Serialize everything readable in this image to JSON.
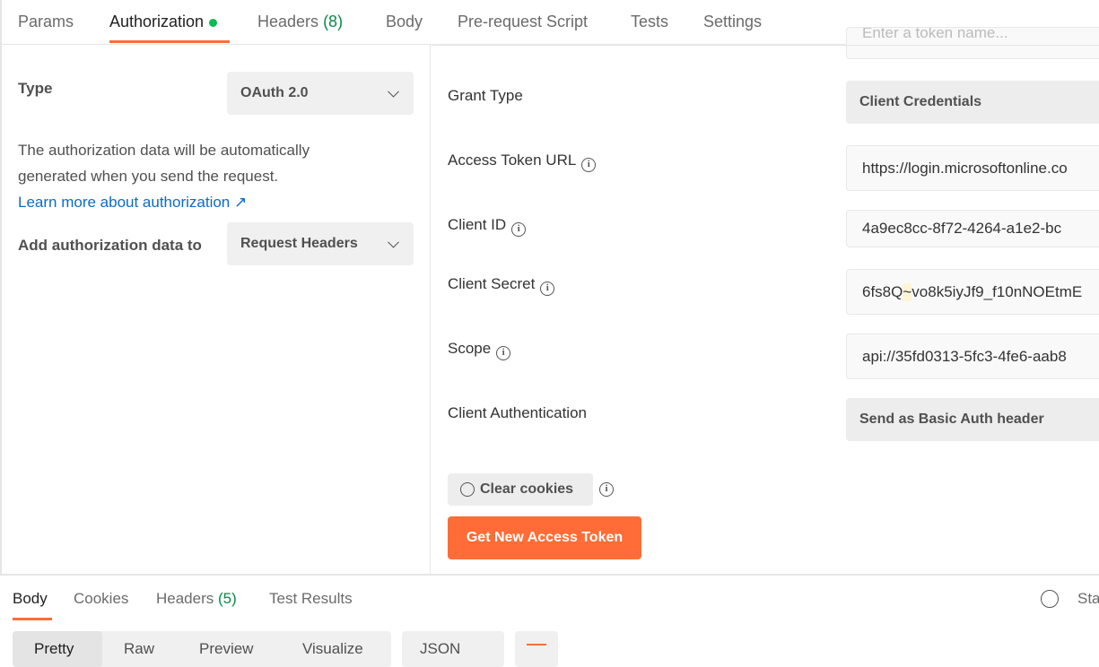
{
  "request_tabs": [
    {
      "label": "Params"
    },
    {
      "label": "Authorization",
      "active": true,
      "indicator_color": "#0cbb52"
    },
    {
      "label": "Headers",
      "count": "(8)"
    },
    {
      "label": "Body"
    },
    {
      "label": "Pre-request Script"
    },
    {
      "label": "Tests"
    },
    {
      "label": "Settings"
    }
  ],
  "auth": {
    "type_label": "Type",
    "type_value": "OAuth 2.0",
    "description": "The authorization data will be automatically generated when you send the request.",
    "learn_more": "Learn more about authorization ↗",
    "add_to_label": "Add authorization data to",
    "add_to_value": "Request Headers"
  },
  "config": {
    "token_name_placeholder": "Enter a token name...",
    "grant_type_label": "Grant Type",
    "grant_type_value": "Client Credentials",
    "access_token_url_label": "Access Token URL",
    "access_token_url_value": "https://login.microsoftonline.co",
    "client_id_label": "Client ID",
    "client_id_value": "4a9ec8cc-8f72-4264-a1e2-bc",
    "client_secret_label": "Client Secret",
    "client_secret_pre": "6fs8Q",
    "client_secret_hl": "~",
    "client_secret_post": "vo8k5iyJf9_f10nNOEtmE",
    "scope_label": "Scope",
    "scope_value": "api://35fd0313-5fc3-4fe6-aab8",
    "client_auth_label": "Client Authentication",
    "client_auth_value": "Send as Basic Auth header",
    "clear_cookies": "Clear cookies",
    "get_token": "Get New Access Token"
  },
  "response_tabs": [
    {
      "label": "Body",
      "active": true
    },
    {
      "label": "Cookies"
    },
    {
      "label": "Headers",
      "count": "(5)"
    },
    {
      "label": "Test Results"
    }
  ],
  "response": {
    "status_partial": "Sta",
    "views": [
      "Pretty",
      "Raw",
      "Preview",
      "Visualize"
    ],
    "format": "JSON"
  },
  "accent": "#ff6c37"
}
